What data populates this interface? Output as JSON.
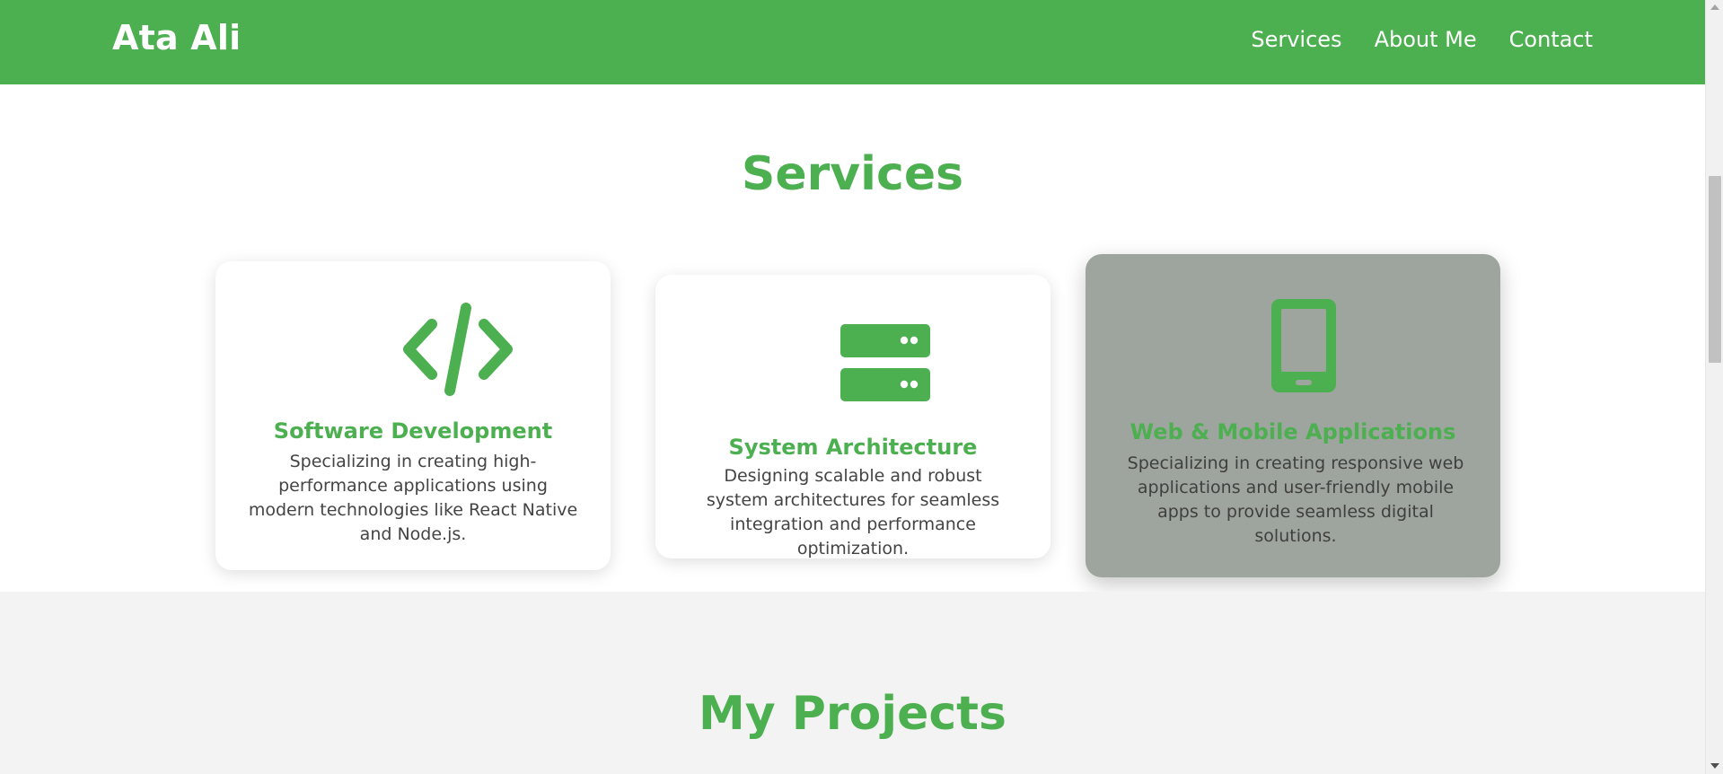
{
  "colors": {
    "brand_green": "#4caf50",
    "header_text": "#ffffff",
    "card_hover_bg": "#9ea59e",
    "projects_bg": "#f3f3f3"
  },
  "header": {
    "brand": "Ata Ali",
    "nav": [
      {
        "label": "Services"
      },
      {
        "label": "About Me"
      },
      {
        "label": "Contact"
      }
    ]
  },
  "services": {
    "title": "Services",
    "cards": [
      {
        "icon": "code-icon",
        "title": "Software Development",
        "description": "Specializing in creating high-performance applications using modern technologies like React Native and Node.js."
      },
      {
        "icon": "server-icon",
        "title": "System Architecture",
        "description": "Designing scalable and robust system architectures for seamless integration and performance optimization."
      },
      {
        "icon": "mobile-phone-icon",
        "title": "Web & Mobile Applications",
        "description": "Specializing in creating responsive web applications and user-friendly mobile apps to provide seamless digital solutions."
      }
    ]
  },
  "projects": {
    "title": "My Projects"
  }
}
